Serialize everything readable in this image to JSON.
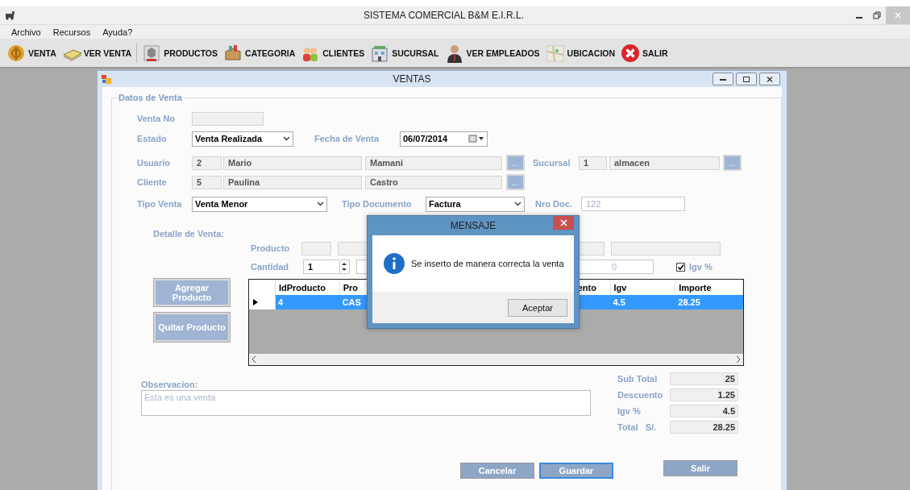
{
  "app_window": {
    "title": "SISTEMA COMERCIAL B&M E.I.R.L."
  },
  "menu": [
    "Archivo",
    "Recursos",
    "Ayuda?"
  ],
  "toolbar": [
    "VENTA",
    "VER VENTA",
    "PRODUCTOS",
    "CATEGORIA",
    "CLIENTES",
    "SUCURSAL",
    "VER EMPLEADOS",
    "UBICACION",
    "SALIR"
  ],
  "form": {
    "title": "VENTAS",
    "group_title": "Datos de Venta",
    "venta_no": {
      "label": "Venta No"
    },
    "estado": {
      "label": "Estado",
      "value": "Venta Realizada"
    },
    "fecha": {
      "label": "Fecha de Venta",
      "value": "06/07/2014"
    },
    "usuario": {
      "label": "Usuario",
      "id": "2",
      "first_name": "Mario",
      "last_name": "Mamani",
      "button": "..."
    },
    "sucursal": {
      "label": "Sucursal",
      "id": "1",
      "name": "almacen",
      "button": "..."
    },
    "cliente": {
      "label": "Cliente",
      "id": "5",
      "first_name": "Paulina",
      "last_name": "Castro",
      "button": "..."
    },
    "tipo_venta": {
      "label": "Tipo Venta",
      "value": "Venta Menor"
    },
    "tipo_documento": {
      "label": "Tipo Documento",
      "value": "Factura"
    },
    "nro_doc": {
      "label": "Nro Doc.",
      "value": "122"
    },
    "detalle": {
      "label": "Detalle de Venta:",
      "producto_label": "Producto",
      "cantidad_label": "Cantidad",
      "cantidad": "1",
      "descuento_value": "0",
      "igv": {
        "label": "Igv %",
        "checked": true
      }
    },
    "side_buttons": [
      "Agregar Producto",
      "Quitar Producto"
    ],
    "table": {
      "columns": [
        "IdProducto",
        "Pro",
        "ento",
        "Igv",
        "Importe"
      ],
      "rows": [
        {
          "selected": true,
          "current": true,
          "cells": [
            "4",
            "CAS",
            null,
            "4.5",
            "28.25"
          ]
        }
      ]
    },
    "observacion": {
      "label": "Observacion:",
      "value": "Esta es una venta"
    },
    "totals": [
      {
        "label": "Sub Total",
        "value": "25"
      },
      {
        "label": "Descuento",
        "value": "1.25"
      },
      {
        "label": "Igv %",
        "value": "4.5"
      },
      {
        "label": "Total   S/.",
        "value": "28.25"
      }
    ],
    "actions": [
      {
        "label": "Cancelar",
        "focused": false
      },
      {
        "label": "Guardar",
        "focused": true
      },
      {
        "label": "Salir",
        "focused": false
      }
    ]
  },
  "dialog": {
    "title": "MENSAJE",
    "message": "Se inserto de manera correcta la venta",
    "button": "Aceptar"
  }
}
